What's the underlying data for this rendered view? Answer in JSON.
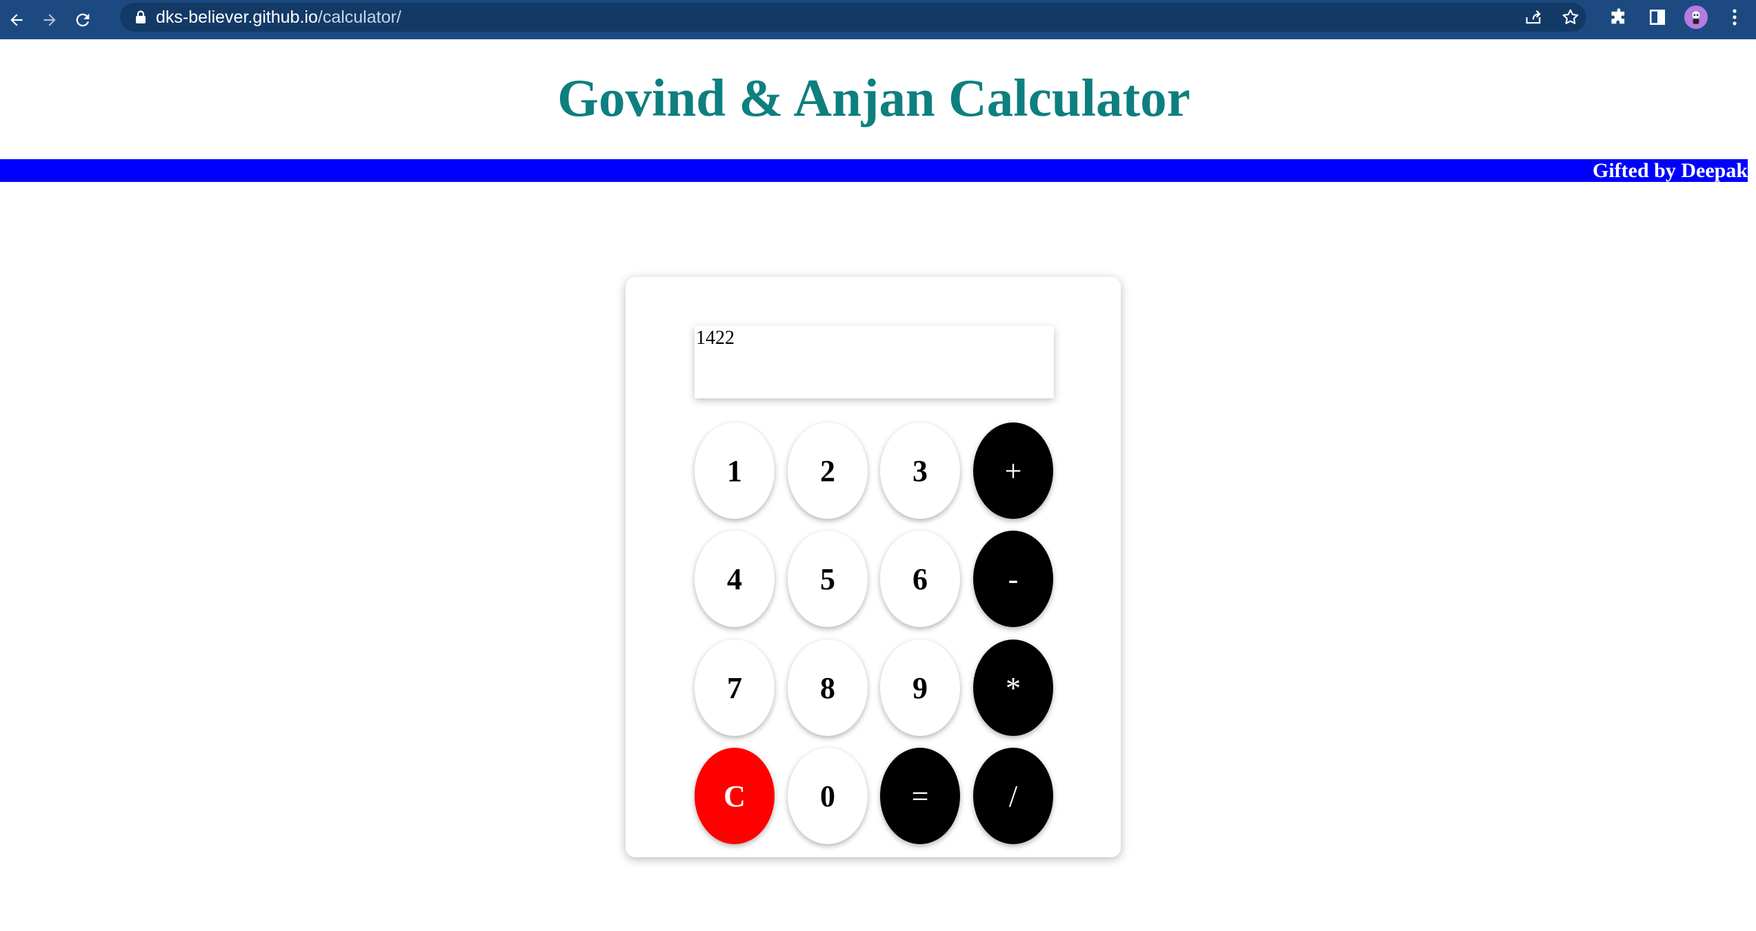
{
  "browser": {
    "url_host": "dks-believer.github.io",
    "url_path": "/calculator/",
    "icons": [
      "back-icon",
      "forward-icon",
      "reload-icon",
      "lock-icon",
      "share-icon",
      "star-icon",
      "extensions-icon",
      "side-panel-icon",
      "profile-avatar",
      "menu-icon"
    ]
  },
  "page": {
    "title": "Govind & Anjan Calculator",
    "banner_text": "Gifted by Deepak",
    "colors": {
      "title": "#0e7f7f",
      "banner": "#0000ff",
      "clear_key": "#ff0000",
      "operator_key": "#000000"
    }
  },
  "calculator": {
    "display_value": "1422",
    "keys": {
      "k1": "1",
      "k2": "2",
      "k3": "3",
      "plus": "+",
      "k4": "4",
      "k5": "5",
      "k6": "6",
      "minus": "-",
      "k7": "7",
      "k8": "8",
      "k9": "9",
      "multiply": "*",
      "clear": "C",
      "k0": "0",
      "equals": "=",
      "divide": "/"
    }
  }
}
